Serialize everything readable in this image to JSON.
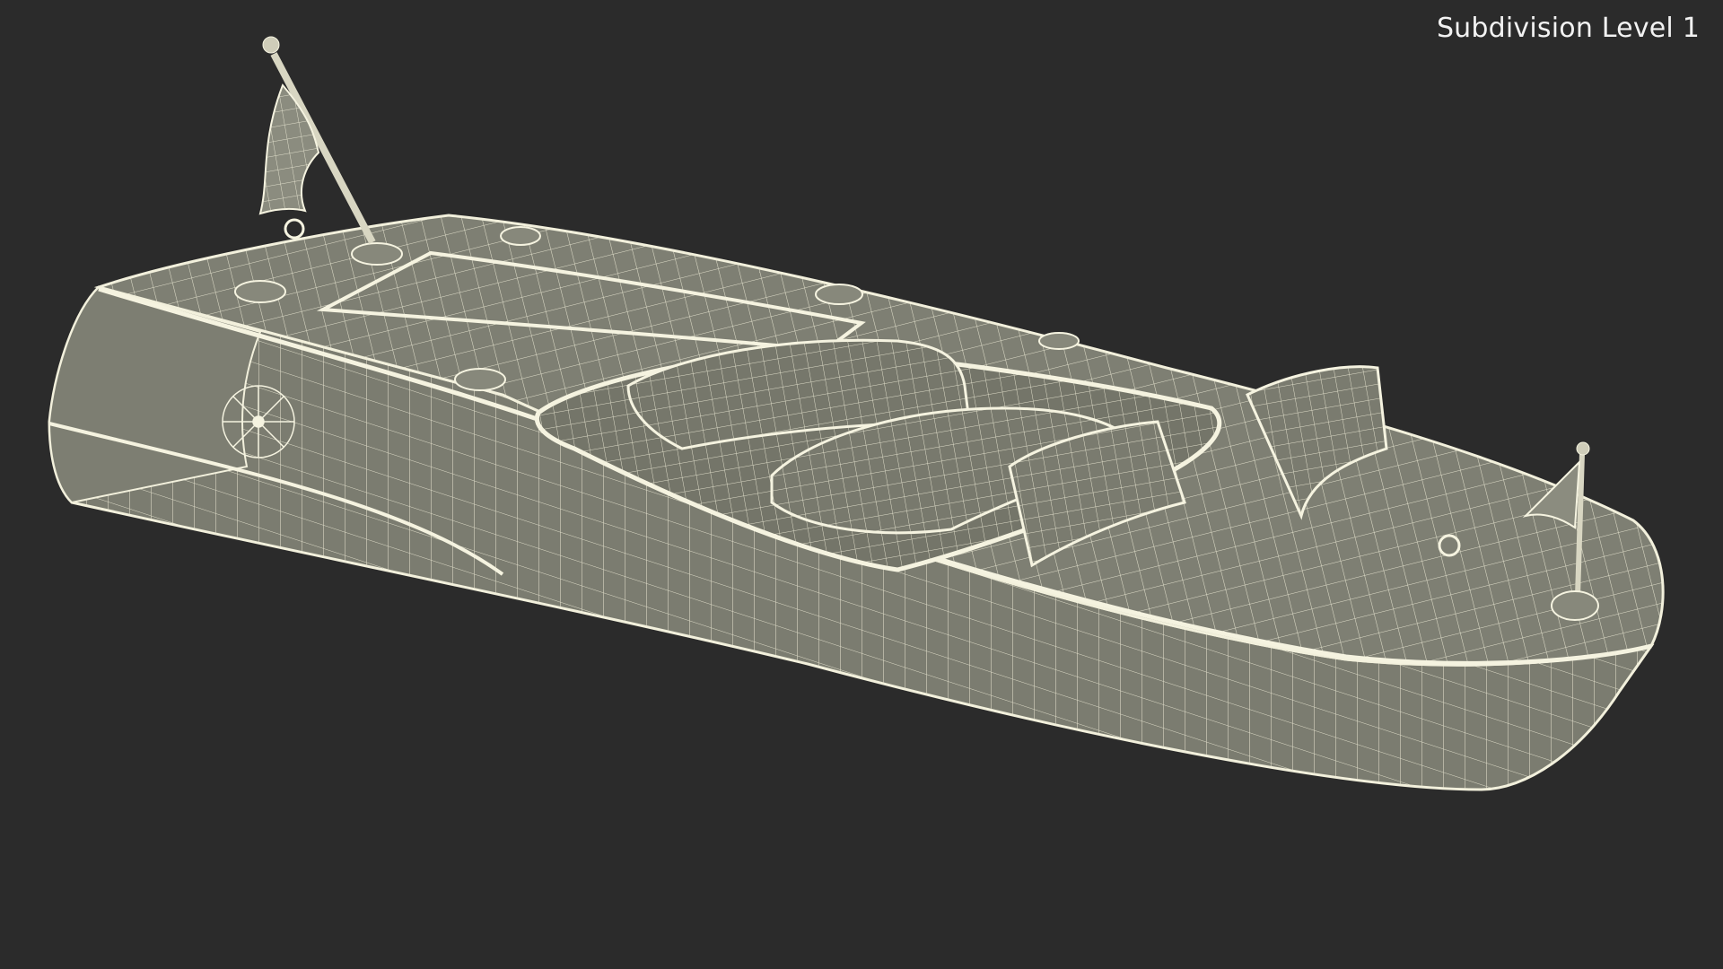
{
  "overlay": {
    "label": "Subdivision Level 1"
  },
  "scene": {
    "subject": "boat-wireframe-render",
    "background_color": "#2b2b2b",
    "surface_color": "#7b7c70",
    "wire_color": "#f2f0dc"
  }
}
